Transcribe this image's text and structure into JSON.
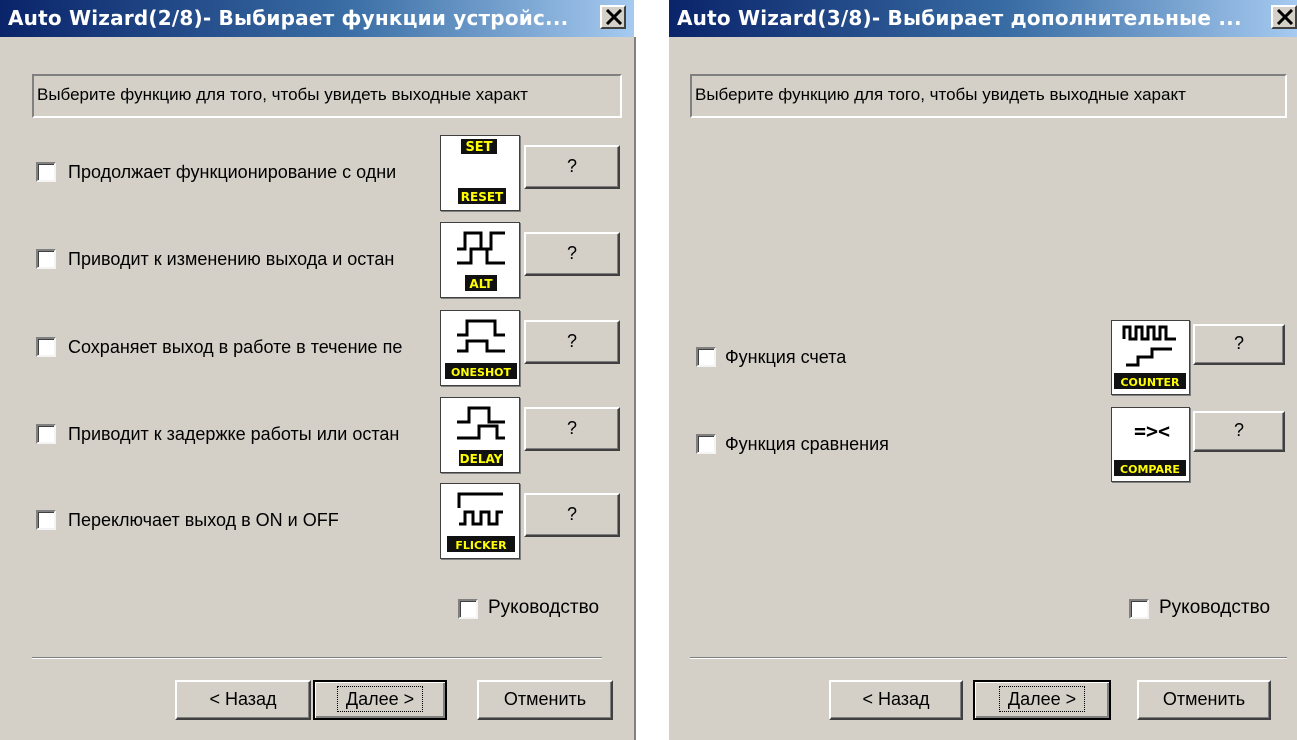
{
  "dialogs": [
    {
      "title": "Auto Wizard(2/8)- Выбирает функции устройс...",
      "header": "Выберите функцию для того, чтобы увидеть выходные характ",
      "options": [
        {
          "label": "Продолжает функционирование с одни",
          "icon": "set-reset-icon",
          "icon_text_top": "SET",
          "icon_text_bottom": "RESET",
          "help": "?"
        },
        {
          "label": "Приводит к изменению выхода и остан",
          "icon": "alt-icon",
          "icon_text_bottom": "ALT",
          "help": "?"
        },
        {
          "label": "Сохраняет выход в работе в течение пе",
          "icon": "oneshot-icon",
          "icon_text_bottom": "ONESHOT",
          "help": "?"
        },
        {
          "label": "Приводит к задержке работы или остан",
          "icon": "delay-icon",
          "icon_text_bottom": "DELAY",
          "help": "?"
        },
        {
          "label": "Переключает выход в ON  и OFF",
          "icon": "flicker-icon",
          "icon_text_bottom": "FLICKER",
          "help": "?"
        }
      ],
      "guide_label": "Руководство",
      "buttons": {
        "back": "< Назад",
        "next": "Далее >",
        "cancel": "Отменить"
      },
      "close": "×"
    },
    {
      "title": "Auto Wizard(3/8)- Выбирает дополнительные ...",
      "header": "Выберите функцию для того, чтобы увидеть выходные характ",
      "options": [
        {
          "label": "Функция счета",
          "icon": "counter-icon",
          "icon_text_bottom": "COUNTER",
          "help": "?"
        },
        {
          "label": "Функция сравнения",
          "icon": "compare-icon",
          "icon_text_top": "=><",
          "icon_text_bottom": "COMPARE",
          "help": "?"
        }
      ],
      "guide_label": "Руководство",
      "buttons": {
        "back": "< Назад",
        "next": "Далее >",
        "cancel": "Отменить"
      },
      "close": "×"
    }
  ],
  "colors": {
    "titlebar_start": "#0a246a",
    "titlebar_end": "#a6caf0",
    "dialog_face": "#d4d0c8",
    "icon_label_fill": "#ffff00"
  }
}
